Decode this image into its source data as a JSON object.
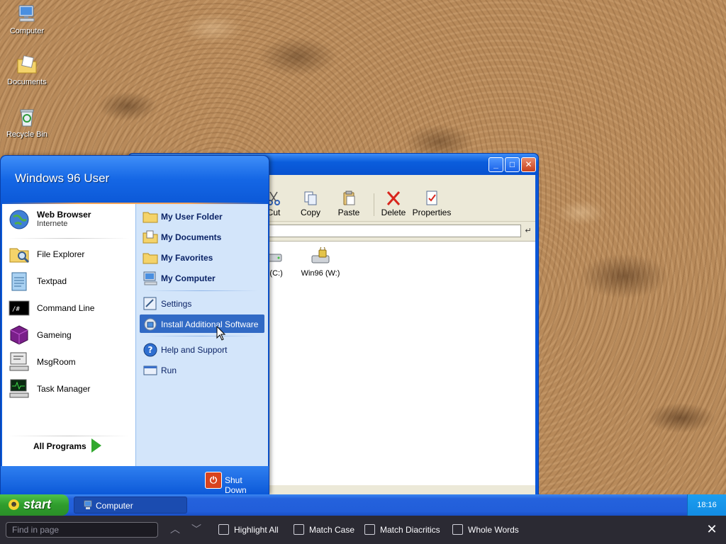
{
  "desktop": {
    "icons": [
      {
        "label": "Computer",
        "icon": "computer-icon"
      },
      {
        "label": "Documents",
        "icon": "documents-folder-icon"
      },
      {
        "label": "Recycle Bin",
        "icon": "recycle-bin-icon"
      }
    ]
  },
  "explorer": {
    "toolbar": {
      "cut": "Cut",
      "copy": "Copy",
      "paste": "Paste",
      "delete": "Delete",
      "properties": "Properties"
    },
    "drives": [
      {
        "label": "n (C:)",
        "icon": "hard-drive-icon"
      },
      {
        "label": "Win96 (W:)",
        "icon": "locked-drive-icon"
      }
    ]
  },
  "start_menu": {
    "user_name": "Windows 96 User",
    "pinned": {
      "label": "Web Browser",
      "sub": "Internete",
      "icon": "globe-icon"
    },
    "programs": [
      {
        "label": "File Explorer",
        "icon": "file-explorer-icon"
      },
      {
        "label": "Textpad",
        "icon": "notepad-icon"
      },
      {
        "label": "Command Line",
        "icon": "terminal-icon"
      },
      {
        "label": "Gameing",
        "icon": "game-cube-icon"
      },
      {
        "label": "MsgRoom",
        "icon": "chat-computer-icon"
      },
      {
        "label": "Task Manager",
        "icon": "task-manager-icon"
      }
    ],
    "all_programs": "All Programs",
    "places": [
      {
        "label": "My User Folder",
        "icon": "folder-icon"
      },
      {
        "label": "My Documents",
        "icon": "documents-icon"
      },
      {
        "label": "My Favorites",
        "icon": "folder-icon"
      },
      {
        "label": "My Computer",
        "icon": "computer-icon"
      }
    ],
    "system": [
      {
        "label": "Settings",
        "icon": "settings-icon"
      },
      {
        "label": "Install Additional Software",
        "icon": "install-software-icon",
        "highlighted": true
      },
      {
        "label": "Help and Support",
        "icon": "help-icon"
      },
      {
        "label": "Run",
        "icon": "run-icon"
      }
    ],
    "shutdown": "Shut Down"
  },
  "taskbar": {
    "start": "start",
    "tasks": [
      {
        "label": "Computer",
        "icon": "computer-icon"
      }
    ],
    "clock": "18:16"
  },
  "findbar": {
    "placeholder": "Find in page",
    "options": [
      "Highlight All",
      "Match Case",
      "Match Diacritics",
      "Whole Words"
    ]
  },
  "colors": {
    "start_green": "#31a82e",
    "xp_blue": "#0a58d6",
    "highlight": "#316ac5",
    "shutdown_red": "#d8431e"
  }
}
